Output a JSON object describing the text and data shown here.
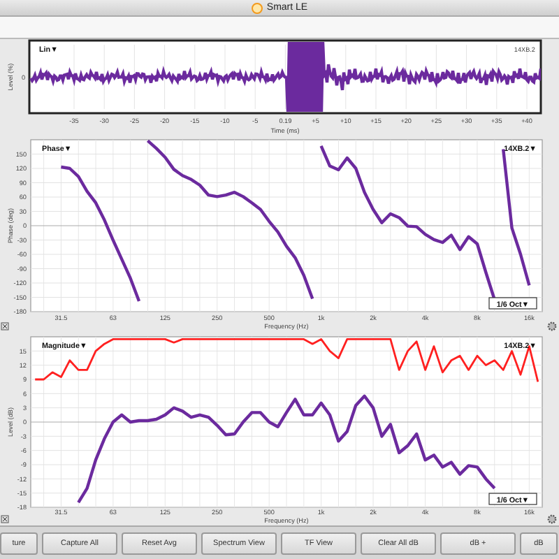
{
  "window": {
    "title": "Smart LE"
  },
  "impulse": {
    "mode": "Lin▼",
    "trace": "14XB.2",
    "ylabel": "Level (%)",
    "y_tick": "0",
    "xlabel": "Time (ms)",
    "x_ticks": [
      "-35",
      "-30",
      "-25",
      "-20",
      "-15",
      "-10",
      "-5",
      "0.19",
      "+5",
      "+10",
      "+15",
      "+20",
      "+25",
      "+30",
      "+35",
      "+40"
    ]
  },
  "phase": {
    "mode": "Phase▼",
    "trace": "14XB.2▼",
    "smoothing": "1/6 Oct▼",
    "chart_data": {
      "type": "line",
      "xlabel": "Frequency (Hz)",
      "ylabel": "Phase (deg)",
      "categories": [
        null,
        null,
        null,
        "31.5",
        null,
        null,
        null,
        null,
        null,
        "63",
        null,
        null,
        null,
        null,
        null,
        "125",
        null,
        null,
        null,
        null,
        null,
        "250",
        null,
        null,
        null,
        null,
        null,
        "500",
        null,
        null,
        null,
        null,
        null,
        "1k",
        null,
        null,
        null,
        null,
        null,
        "2k",
        null,
        null,
        null,
        null,
        null,
        "4k",
        null,
        null,
        null,
        null,
        null,
        "8k",
        null,
        null,
        null,
        null,
        null,
        "16k",
        null
      ],
      "series": [
        {
          "color": "#6b2a9e",
          "values": [
            null,
            null,
            null,
            123,
            120,
            103,
            72,
            48,
            12,
            -30,
            -70,
            -110,
            -158,
            178,
            162,
            143,
            118,
            105,
            97,
            85,
            64,
            61,
            64,
            70,
            61,
            48,
            34,
            9,
            -13,
            -43,
            -67,
            -104,
            -153,
            167,
            125,
            117,
            142,
            120,
            70,
            34,
            6,
            25,
            17,
            -1,
            -2,
            -18,
            -29,
            -35,
            -20,
            -50,
            -23,
            -38,
            -98,
            -155,
            160,
            -5,
            -60,
            -125,
            null
          ]
        }
      ],
      "ylim": [
        -180,
        180
      ],
      "grid": true,
      "yticks": [
        150,
        120,
        90,
        60,
        30,
        0,
        -30,
        -60,
        -90,
        -120,
        -150,
        -180
      ]
    }
  },
  "magnitude": {
    "mode": "Magnitude▼",
    "trace": "14XB.2▼",
    "smoothing": "1/6 Oct▼",
    "chart_data": {
      "type": "line",
      "xlabel": "Frequency (Hz)",
      "ylabel": "Level (dB)",
      "categories": [
        null,
        null,
        null,
        "31.5",
        null,
        null,
        null,
        null,
        null,
        "63",
        null,
        null,
        null,
        null,
        null,
        "125",
        null,
        null,
        null,
        null,
        null,
        "250",
        null,
        null,
        null,
        null,
        null,
        "500",
        null,
        null,
        null,
        null,
        null,
        "1k",
        null,
        null,
        null,
        null,
        null,
        "2k",
        null,
        null,
        null,
        null,
        null,
        "4k",
        null,
        null,
        null,
        null,
        null,
        "8k",
        null,
        null,
        null,
        null,
        null,
        "16k",
        null
      ],
      "series": [
        {
          "color": "#ff2020",
          "values": [
            9,
            9,
            10.5,
            9.5,
            13,
            11,
            11,
            15,
            16.5,
            17.5,
            17.5,
            17.5,
            17.5,
            17.5,
            17.5,
            17.5,
            16.8,
            17.5,
            17.5,
            17.5,
            17.5,
            17.5,
            17.5,
            17.5,
            17.5,
            17.5,
            17.5,
            17.5,
            17.5,
            17.5,
            17.5,
            17.5,
            16.5,
            17.5,
            15,
            13.5,
            17.5,
            17.5,
            17.5,
            17.5,
            17.5,
            17.5,
            11,
            15,
            17,
            11,
            16,
            10.5,
            13,
            14,
            11,
            14,
            12,
            13,
            11,
            15,
            10,
            16,
            8.5
          ]
        },
        {
          "color": "#6b2a9e",
          "values": [
            null,
            null,
            null,
            null,
            null,
            -17,
            -14,
            -8,
            -3.5,
            0,
            1.5,
            0,
            0.3,
            0.3,
            0.6,
            1.5,
            3,
            2.3,
            1,
            1.5,
            1,
            -0.7,
            -2.7,
            -2.5,
            0,
            2,
            2,
            0,
            -1,
            2,
            4.8,
            1.5,
            1.5,
            4,
            1.5,
            -4,
            -2,
            3.5,
            5.5,
            3,
            -3,
            -0.5,
            -6.5,
            -5,
            -2.5,
            -8,
            -7,
            -9.5,
            -8.5,
            -11,
            -9.2,
            -9.5,
            -12,
            -14,
            null,
            null,
            null,
            null,
            null
          ]
        }
      ],
      "ylim": [
        -18,
        18
      ],
      "grid": true,
      "yticks": [
        15,
        12,
        9,
        6,
        3,
        0,
        -3,
        -6,
        -9,
        -12,
        -15,
        -18
      ]
    }
  },
  "buttons": [
    "ture",
    "Capture All",
    "Reset Avg",
    "Spectrum View",
    "TF View",
    "Clear All dB",
    "dB +",
    "dB"
  ]
}
